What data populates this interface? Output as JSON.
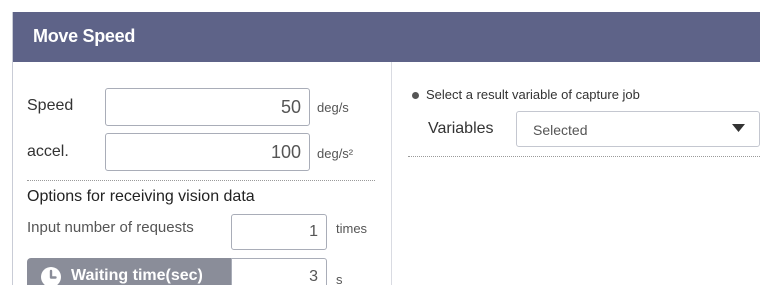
{
  "header": {
    "title": "Move Speed"
  },
  "speed": {
    "label": "Speed",
    "value": "50",
    "unit": "deg/s"
  },
  "accel": {
    "label": "accel.",
    "value": "100",
    "unit": "deg/s²"
  },
  "vision": {
    "section_title": "Options for receiving vision data",
    "requests_label": "Input number of requests",
    "requests_value": "1",
    "requests_unit": "times",
    "waiting_label": "Waiting time(sec)",
    "waiting_value": "3",
    "waiting_unit": "s",
    "waiting_icon": "clock-icon"
  },
  "capture": {
    "note": "Select a result variable of capture job",
    "variables_label": "Variables",
    "variables_value": "Selected",
    "dropdown_icon": "caret-down-icon"
  },
  "colors": {
    "header_bg": "#5e6388",
    "button_bg": "#8a8d99"
  }
}
